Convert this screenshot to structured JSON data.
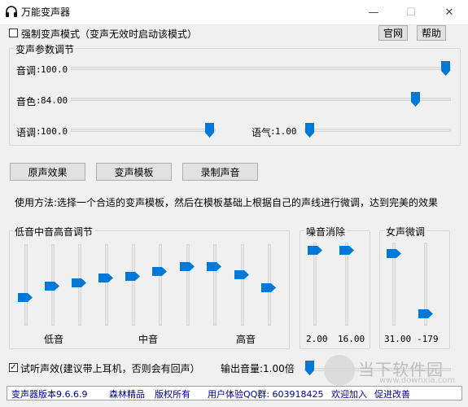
{
  "window": {
    "title": "万能变声器",
    "min": "—",
    "max": "☐",
    "close": "✕"
  },
  "top": {
    "force_mode_label": "强制变声模式（变声无效时启动该模式）",
    "website_btn": "官网",
    "help_btn": "帮助"
  },
  "params": {
    "group_label": "变声参数调节",
    "pitch": {
      "label": "音调",
      "value": "100.0"
    },
    "timbre": {
      "label": "音色",
      "value": "84.00"
    },
    "speed": {
      "label": "语调",
      "value": "100.0"
    },
    "tone": {
      "label": "语气",
      "value": "1.00"
    }
  },
  "buttons": {
    "original": "原声效果",
    "templates": "变声模板",
    "record": "录制声音"
  },
  "usage": "使用方法:选择一个合适的变声模板，然后在模板基础上根据自己的声线进行微调，达到完美的效果",
  "eq": {
    "group_label": "低音中音高音调节",
    "low": "低音",
    "mid": "中音",
    "high": "高音"
  },
  "noise": {
    "group_label": "噪音消除",
    "v1": "2.00",
    "v2": "16.00"
  },
  "female": {
    "group_label": "女声微调",
    "v1": "31.00",
    "v2": "-179"
  },
  "bottom": {
    "listen_label": "试听声效(建议带上耳机，否则会有回声）",
    "volume_label": "输出音量:1.00倍"
  },
  "status": {
    "version": "变声器版本9.6.6.9",
    "brand": "森林精品",
    "rights": "版权所有",
    "qq": "用户体验QQ群: 603918425",
    "welcome": "欢迎加入",
    "improve": "促进改善"
  },
  "watermark": {
    "text": "当下软件园",
    "url": "www.downxia.com"
  },
  "colors": {
    "accent": "#0078d7",
    "status_text": "#00008b"
  }
}
